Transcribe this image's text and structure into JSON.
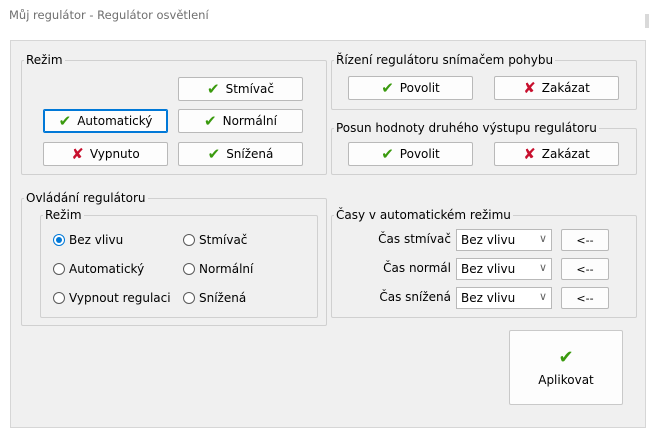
{
  "window": {
    "title": "Můj regulátor - Regulátor osvětlení"
  },
  "rezim": {
    "legend": "Režim",
    "stmivac": "Stmívač",
    "automaticky": "Automatický",
    "normalni": "Normální",
    "vypnuto": "Vypnuto",
    "snizena": "Snížená"
  },
  "rizeni": {
    "legend": "Řízení regulátoru snímačem pohybu",
    "povolit": "Povolit",
    "zakazat": "Zakázat"
  },
  "posun": {
    "legend": "Posun hodnoty druhého výstupu regulátoru",
    "povolit": "Povolit",
    "zakazat": "Zakázat"
  },
  "ovladani": {
    "legend": "Ovládání regulátoru",
    "rezim_legend": "Režim",
    "radios": [
      {
        "label": "Bez vlivu",
        "checked": true
      },
      {
        "label": "Stmívač",
        "checked": false
      },
      {
        "label": "Automatický",
        "checked": false
      },
      {
        "label": "Normální",
        "checked": false
      },
      {
        "label": "Vypnout regulaci",
        "checked": false
      },
      {
        "label": "Snížená",
        "checked": false
      }
    ]
  },
  "casy": {
    "legend": "Časy v automatickém režimu",
    "rows": [
      {
        "label": "Čas stmívač",
        "value": "Bez vlivu",
        "button": "<--"
      },
      {
        "label": "Čas normál",
        "value": "Bez vlivu",
        "button": "<--"
      },
      {
        "label": "Čas snížená",
        "value": "Bez vlivu",
        "button": "<--"
      }
    ]
  },
  "apply": {
    "label": "Aplikovat"
  },
  "icons": {
    "check": "check-icon",
    "cross": "cross-icon",
    "dropdown": "chevron-down-icon"
  },
  "colors": {
    "check": "#3a9a0e",
    "cross": "#c8102e",
    "focus": "#0078d7"
  }
}
